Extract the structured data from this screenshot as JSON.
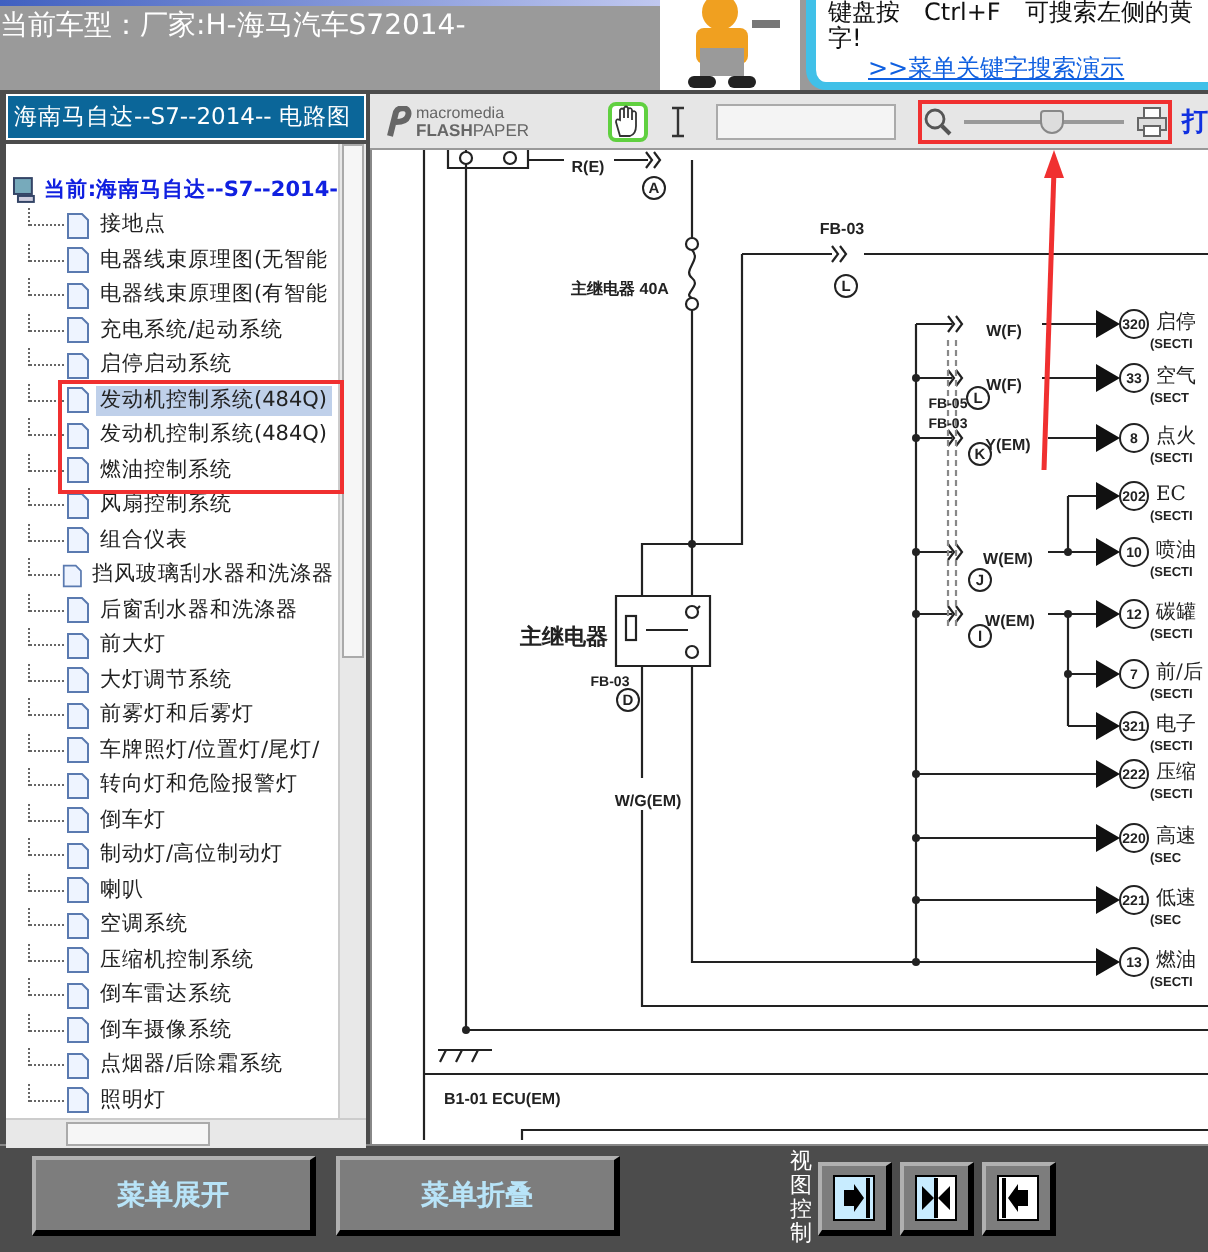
{
  "header": {
    "title": "当前车型：厂家:H-海马汽车S72014-",
    "tip_lines": [
      "键盘按　Ctrl+F　可搜索左侧的黄",
      "字!"
    ],
    "tip_link": ">>菜单关键字搜索演示"
  },
  "sidebar": {
    "title": "海南马自达--S7--2014-- 电路图",
    "root": "当前:海南马自达--S7--2014-",
    "items": [
      {
        "label": "接地点",
        "selected": false
      },
      {
        "label": "电器线束原理图(无智能",
        "selected": false
      },
      {
        "label": "电器线束原理图(有智能",
        "selected": false
      },
      {
        "label": "充电系统/起动系统",
        "selected": false
      },
      {
        "label": "启停启动系统",
        "selected": false
      },
      {
        "label": "发动机控制系统(484Q)",
        "selected": true
      },
      {
        "label": "发动机控制系统(484Q)",
        "selected": false
      },
      {
        "label": "燃油控制系统",
        "selected": false
      },
      {
        "label": "风扇控制系统",
        "selected": false
      },
      {
        "label": "组合仪表",
        "selected": false
      },
      {
        "label": "挡风玻璃刮水器和洗涤器",
        "selected": false
      },
      {
        "label": "后窗刮水器和洗涤器",
        "selected": false
      },
      {
        "label": "前大灯",
        "selected": false
      },
      {
        "label": "大灯调节系统",
        "selected": false
      },
      {
        "label": "前雾灯和后雾灯",
        "selected": false
      },
      {
        "label": "车牌照灯/位置灯/尾灯/",
        "selected": false
      },
      {
        "label": "转向灯和危险报警灯",
        "selected": false
      },
      {
        "label": "倒车灯",
        "selected": false
      },
      {
        "label": "制动灯/高位制动灯",
        "selected": false
      },
      {
        "label": "喇叭",
        "selected": false
      },
      {
        "label": "空调系统",
        "selected": false
      },
      {
        "label": "压缩机控制系统",
        "selected": false
      },
      {
        "label": "倒车雷达系统",
        "selected": false
      },
      {
        "label": "倒车摄像系统",
        "selected": false
      },
      {
        "label": "点烟器/后除霜系统",
        "selected": false
      },
      {
        "label": "照明灯",
        "selected": false
      }
    ]
  },
  "viewer": {
    "logo": "macromedia",
    "logo_product": "**FLASH**PAPER",
    "tools": [
      {
        "kind": "hand",
        "selected": true
      },
      {
        "kind": "text",
        "selected": false
      }
    ],
    "zoom": {
      "level": 0.55
    },
    "print_label": "打",
    "diagram": {
      "labels": [
        {
          "text": "R(E)",
          "kind": "text"
        },
        {
          "text": "A",
          "kind": "circled"
        },
        {
          "text": "FB-03",
          "kind": "text"
        },
        {
          "text": "L",
          "kind": "circled"
        },
        {
          "text": "主继电器 40A",
          "kind": "text"
        },
        {
          "text": "W(F)",
          "kind": "text"
        },
        {
          "text": "W(F)",
          "kind": "text"
        },
        {
          "text": "FB-05",
          "kind": "text"
        },
        {
          "text": "L",
          "kind": "circled"
        },
        {
          "text": "FB-03",
          "kind": "text"
        },
        {
          "text": "Y(EM)",
          "kind": "text"
        },
        {
          "text": "K",
          "kind": "circled"
        },
        {
          "text": "W(EM)",
          "kind": "text"
        },
        {
          "text": "J",
          "kind": "circled"
        },
        {
          "text": "W(EM)",
          "kind": "text"
        },
        {
          "text": "I",
          "kind": "circled"
        },
        {
          "text": "主继电器",
          "kind": "text"
        },
        {
          "text": "FB-03",
          "kind": "text"
        },
        {
          "text": "D",
          "kind": "circled"
        },
        {
          "text": "W/G(EM)",
          "kind": "text"
        },
        {
          "text": "B1-01  ECU(EM)",
          "kind": "text"
        }
      ],
      "targets": [
        {
          "number": "320",
          "label": "启停",
          "section": "(SECTI"
        },
        {
          "number": "33",
          "label": "空气",
          "section": "(SECT"
        },
        {
          "number": "8",
          "label": "点火",
          "section": "(SECTI"
        },
        {
          "number": "202",
          "label": "EC",
          "section": "(SECTI"
        },
        {
          "number": "10",
          "label": "喷油",
          "section": "(SECTI"
        },
        {
          "number": "12",
          "label": "碳罐",
          "section": "(SECTI"
        },
        {
          "number": "7",
          "label": "前/后",
          "section": "(SECTI"
        },
        {
          "number": "321",
          "label": "电子",
          "section": "(SECTI"
        },
        {
          "number": "222",
          "label": "压缩",
          "section": "(SECTI"
        },
        {
          "number": "220",
          "label": "高速",
          "section": "(SEC"
        },
        {
          "number": "221",
          "label": "低速",
          "section": "(SEC"
        },
        {
          "number": "13",
          "label": "燃油",
          "section": "(SECTI"
        }
      ]
    }
  },
  "footer": {
    "buttons": [
      "菜单展开",
      "菜单折叠"
    ],
    "view_label": "视图控制"
  }
}
